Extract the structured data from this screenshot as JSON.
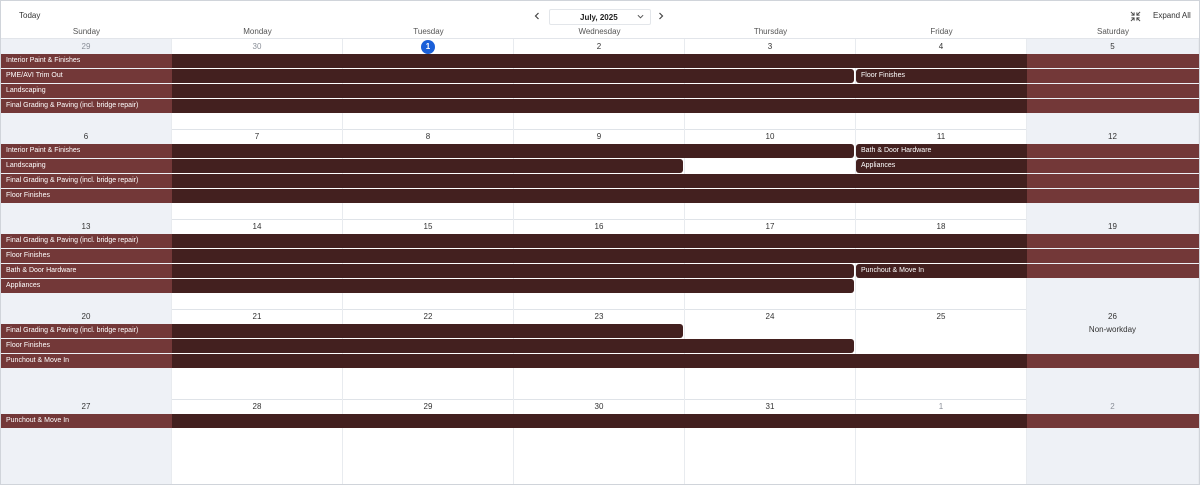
{
  "toolbar": {
    "today_label": "Today",
    "month_label": "July, 2025",
    "expand_all_label": "Expand All",
    "icons": {
      "prev": "chevron-left-icon",
      "next": "chevron-right-icon",
      "dropdown": "chevron-down-icon",
      "collapse": "collapse-icon"
    }
  },
  "day_names": [
    "Sunday",
    "Monday",
    "Tuesday",
    "Wednesday",
    "Thursday",
    "Friday",
    "Saturday"
  ],
  "colors": {
    "event": "#43201f",
    "event_weekend": "#733838",
    "today": "#1a5fd8",
    "weekend_bg": "#eef1f6"
  },
  "weeks": [
    {
      "dates": [
        "29",
        "30",
        "1",
        "2",
        "3",
        "4",
        "5"
      ],
      "outside": [
        true,
        true,
        false,
        false,
        false,
        false,
        false
      ],
      "today_index": 2,
      "events": [
        {
          "label": "Interior Paint & Finishes",
          "start": 0,
          "end": 6
        },
        {
          "label": "PME/AVI Trim Out",
          "start": 0,
          "end": 4
        },
        {
          "label": "Landscaping",
          "start": 0,
          "end": 6
        },
        {
          "label": "Final Grading & Paving (incl. bridge repair)",
          "start": 0,
          "end": 6
        }
      ]
    },
    {
      "dates": [
        "6",
        "7",
        "8",
        "9",
        "10",
        "11",
        "12"
      ],
      "outside": [
        false,
        false,
        false,
        false,
        false,
        false,
        false
      ],
      "events": [
        {
          "label": "Interior Paint & Finishes",
          "start": 0,
          "end": 4
        },
        {
          "label": "Landscaping",
          "start": 0,
          "end": 3
        },
        {
          "label": "Final Grading & Paving (incl. bridge repair)",
          "start": 0,
          "end": 6
        },
        {
          "label": "Floor Finishes",
          "start": 0,
          "end": 6
        }
      ]
    },
    {
      "dates": [
        "13",
        "14",
        "15",
        "16",
        "17",
        "18",
        "19"
      ],
      "outside": [
        false,
        false,
        false,
        false,
        false,
        false,
        false
      ],
      "events": [
        {
          "label": "Final Grading & Paving (incl. bridge repair)",
          "start": 0,
          "end": 6
        },
        {
          "label": "Floor Finishes",
          "start": 0,
          "end": 6
        },
        {
          "label": "Bath & Door Hardware",
          "start": 0,
          "end": 4
        },
        {
          "label": "Appliances",
          "start": 0,
          "end": 4
        }
      ]
    },
    {
      "dates": [
        "20",
        "21",
        "22",
        "23",
        "24",
        "25",
        "26"
      ],
      "outside": [
        false,
        false,
        false,
        false,
        false,
        false,
        false
      ],
      "nonworkday_index": 6,
      "nonworkday_label": "Non-workday",
      "events": [
        {
          "label": "Final Grading & Paving (incl. bridge repair)",
          "start": 0,
          "end": 3
        },
        {
          "label": "Floor Finishes",
          "start": 0,
          "end": 4
        },
        {
          "label": "Punchout & Move In",
          "start": 0,
          "end": 6
        }
      ]
    },
    {
      "dates": [
        "27",
        "28",
        "29",
        "30",
        "31",
        "1",
        "2"
      ],
      "outside": [
        false,
        false,
        false,
        false,
        false,
        true,
        true
      ],
      "events": [
        {
          "label": "Punchout & Move In",
          "start": 0,
          "end": 6
        }
      ]
    }
  ],
  "extra_events": [
    {
      "week": 0,
      "row": 1,
      "label": "Floor Finishes",
      "start": 5,
      "end": 6
    },
    {
      "week": 1,
      "row": 0,
      "label": "Bath & Door Hardware",
      "start": 5,
      "end": 6
    },
    {
      "week": 1,
      "row": 1,
      "label": "Appliances",
      "start": 5,
      "end": 6
    },
    {
      "week": 2,
      "row": 2,
      "label": "Punchout & Move In",
      "start": 5,
      "end": 6
    }
  ]
}
